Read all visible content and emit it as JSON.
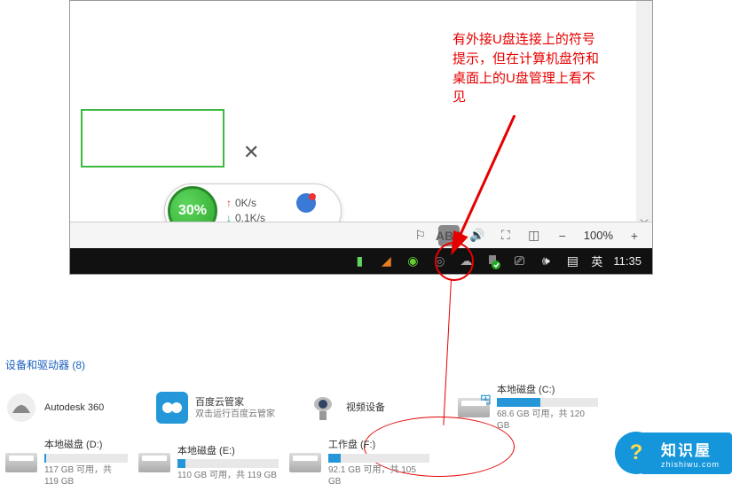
{
  "annotation": {
    "text": "有外接U盘连接上的符号提示，但在计算机盘符和桌面上的U盘管理上看不见"
  },
  "speed": {
    "percent": "30%",
    "up": "0K/s",
    "down": "0.1K/s"
  },
  "toolbar": {
    "adp_label": "ABP",
    "zoom": "100%",
    "minus": "−",
    "plus": "+"
  },
  "taskbar": {
    "ime": "英",
    "time": "11:35"
  },
  "devices": {
    "header": "设备和驱动器 (8)",
    "items": [
      {
        "title": "Autodesk 360",
        "sub": ""
      },
      {
        "title": "百度云管家",
        "sub": "双击运行百度云管家"
      },
      {
        "title": "视频设备",
        "sub": ""
      },
      {
        "title": "本地磁盘 (C:)",
        "sub": "68.6 GB 可用，共 120 GB",
        "fill": 43
      },
      {
        "title": "本地磁盘 (D:)",
        "sub": "117 GB 可用，共 119 GB",
        "fill": 2
      },
      {
        "title": "本地磁盘 (E:)",
        "sub": "110 GB 可用，共 119 GB",
        "fill": 8
      },
      {
        "title": "工作盘 (F:)",
        "sub": "92.1 GB 可用，共 105 GB",
        "fill": 12
      }
    ]
  },
  "watermark": {
    "title": "知识屋",
    "url": "zhishiwu.com"
  }
}
